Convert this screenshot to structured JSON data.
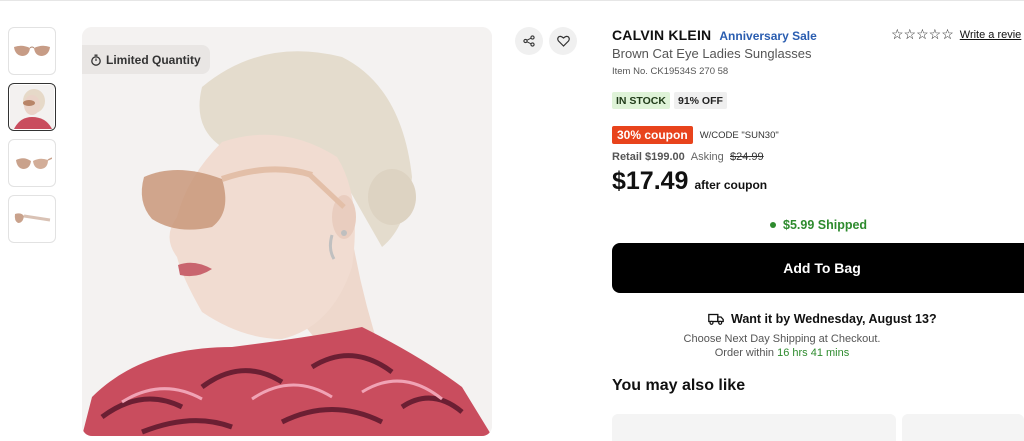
{
  "gallery": {
    "badge": "Limited Quantity",
    "thumbnails": [
      "sunglasses-front",
      "model-side",
      "sunglasses-angle",
      "sunglasses-side"
    ]
  },
  "product": {
    "brand": "CALVIN KLEIN",
    "sale_label": "Anniversary Sale",
    "title": "Brown Cat Eye Ladies Sunglasses",
    "item_no": "Item No. CK19534S 270 58",
    "rating_stars": "☆☆☆☆☆",
    "review_link": "Write a revie",
    "stock_tag": "IN STOCK",
    "discount_tag": "91% OFF",
    "coupon": "30% coupon",
    "coupon_code": "W/CODE \"SUN30\"",
    "retail_label": "Retail $199.00",
    "asking_label": "Asking",
    "asking_price": "$24.99",
    "final_price": "$17.49",
    "after_coupon": "after coupon",
    "shipping": "$5.99 Shipped",
    "add_to_bag": "Add To Bag",
    "delivery_headline": "Want it by Wednesday, August 13?",
    "delivery_note": "Choose Next Day Shipping at Checkout.",
    "order_within_prefix": "Order within",
    "order_within_time": "16 hrs 41 mins"
  },
  "recommendations": {
    "heading": "You may also like"
  },
  "colors": {
    "coupon": "#e8431c",
    "sale": "#2a5db0",
    "instock_bg": "#dff3d8",
    "shipping_green": "#2e8b2e",
    "button": "#000000"
  }
}
